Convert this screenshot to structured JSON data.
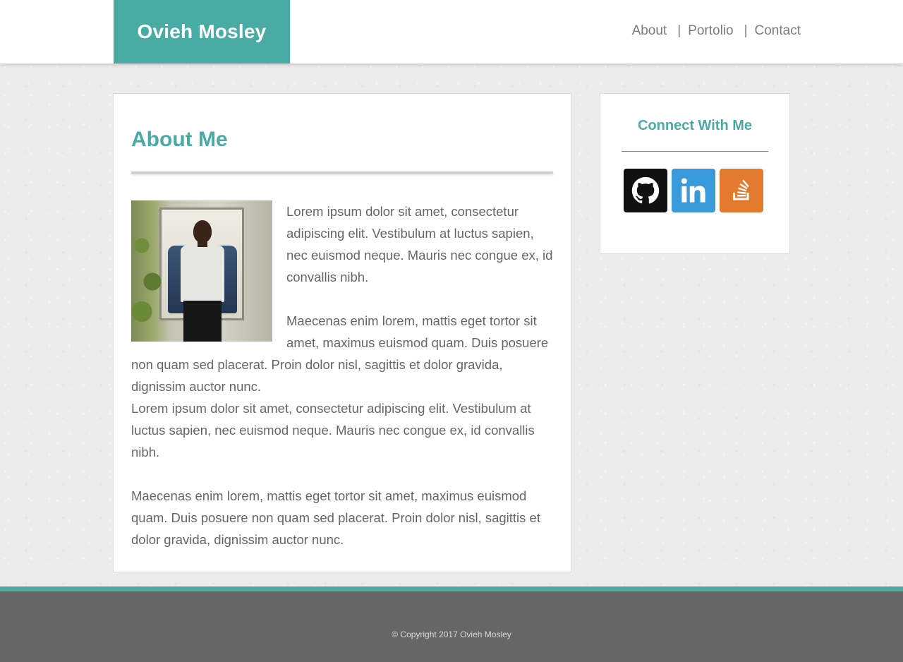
{
  "header": {
    "brand": "Ovieh Mosley",
    "nav": [
      {
        "label": "About"
      },
      {
        "label": "Portolio"
      },
      {
        "label": "Contact"
      }
    ],
    "separator": "|"
  },
  "main": {
    "title": "About Me",
    "photo_alt": "Ovieh Mosley portrait",
    "paragraphs": [
      "Lorem ipsum dolor sit amet, consectetur adipiscing elit. Vestibulum at luctus sapien, nec euismod neque. Mauris nec congue ex, id convallis nibh.",
      "Maecenas enim lorem, mattis eget tortor sit amet, maximus euismod quam. Duis posuere non quam sed placerat. Proin dolor nisl, sagittis et dolor gravida, dignissim auctor nunc.",
      "Lorem ipsum dolor sit amet, consectetur adipiscing elit. Vestibulum at luctus sapien, nec euismod neque. Mauris nec congue ex, id convallis nibh.",
      "Maecenas enim lorem, mattis eget tortor sit amet, maximus euismod quam. Duis posuere non quam sed placerat. Proin dolor nisl, sagittis et dolor gravida, dignissim auctor nunc."
    ]
  },
  "sidebar": {
    "title": "Connect With Me",
    "social": [
      {
        "name": "github-icon",
        "color": "#111111"
      },
      {
        "name": "linkedin-icon",
        "color": "#3a9ad9"
      },
      {
        "name": "stackoverflow-icon",
        "color": "#e27b2d"
      }
    ]
  },
  "footer": {
    "copyright": "© Copyright 2017 Ovieh Mosley"
  },
  "colors": {
    "accent": "#4aaba5",
    "footer_bg": "#666666",
    "text": "#666666"
  }
}
